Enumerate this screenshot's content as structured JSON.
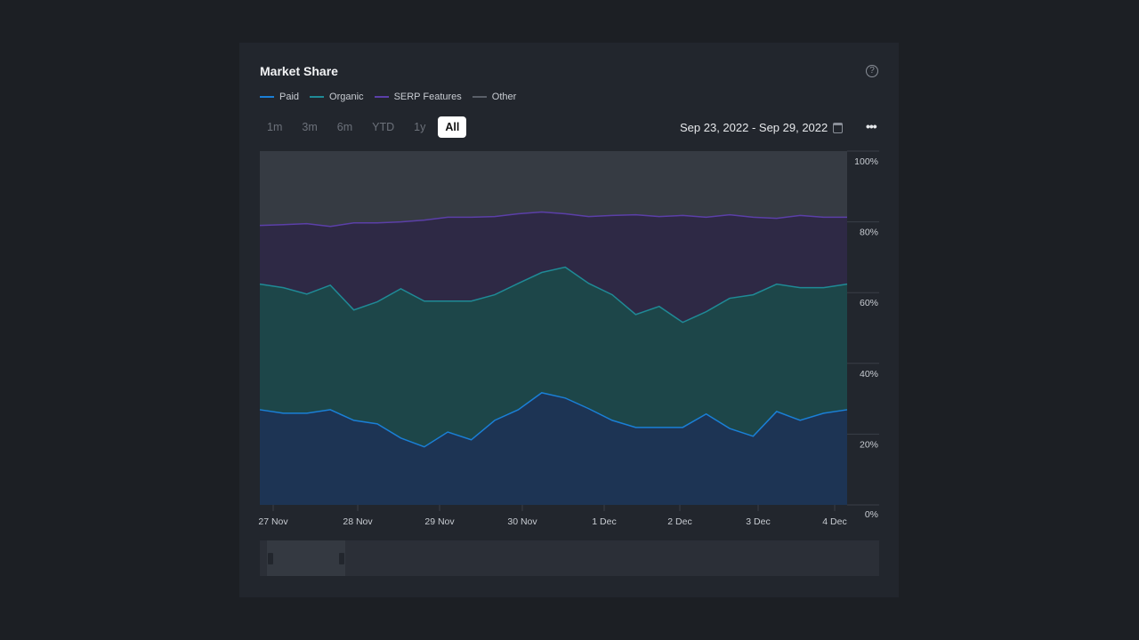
{
  "card": {
    "title": "Market Share",
    "help_icon": "question-circle-icon",
    "more_icon": "ellipsis-icon",
    "calendar_icon": "calendar-icon"
  },
  "ranges": [
    {
      "label": "1m"
    },
    {
      "label": "3m"
    },
    {
      "label": "6m"
    },
    {
      "label": "YTD"
    },
    {
      "label": "1y"
    },
    {
      "label": "All",
      "active": true
    }
  ],
  "date_range": "Sep 23, 2022 - Sep 29, 2022",
  "chart_data": {
    "type": "area",
    "stacked": true,
    "legend_position": "top-left",
    "series": [
      {
        "name": "Paid",
        "color": "#1a7fd6",
        "fill": "#1d3454",
        "values": [
          26.9,
          25.9,
          25.9,
          26.9,
          23.9,
          22.9,
          18.9,
          16.4,
          20.6,
          18.4,
          23.9,
          26.9,
          31.7,
          30.2,
          27.2,
          23.9,
          21.9,
          21.9,
          21.9,
          25.7,
          21.6,
          19.4,
          26.4,
          23.9,
          25.9,
          26.9
        ]
      },
      {
        "name": "Organic",
        "color": "#1f8a96",
        "fill": "#1d4649",
        "values": [
          35.5,
          35.5,
          33.7,
          35.2,
          31.2,
          34.5,
          42.2,
          41.2,
          37.0,
          39.2,
          35.5,
          35.7,
          34.0,
          37.0,
          35.4,
          35.5,
          31.9,
          34.2,
          29.7,
          28.9,
          36.8,
          40.0,
          36.0,
          37.5,
          35.5,
          35.5
        ]
      },
      {
        "name": "SERP Features",
        "color": "#5b3fa8",
        "fill": "#2e2945",
        "values": [
          16.6,
          17.8,
          19.9,
          16.6,
          24.6,
          22.3,
          18.9,
          22.9,
          23.7,
          23.7,
          22.1,
          19.7,
          17.1,
          15.1,
          18.9,
          22.4,
          28.2,
          25.4,
          30.2,
          26.7,
          23.6,
          21.9,
          18.6,
          20.4,
          19.9,
          18.9
        ]
      },
      {
        "name": "Other",
        "color": "#5a5f68",
        "fill": "#363b43",
        "values": [
          21.0,
          20.8,
          20.5,
          21.3,
          20.3,
          20.3,
          20.0,
          19.5,
          18.7,
          18.7,
          18.5,
          17.7,
          17.2,
          17.7,
          18.5,
          18.2,
          18.0,
          18.5,
          18.2,
          18.7,
          18.0,
          18.7,
          19.0,
          18.2,
          18.7,
          18.7
        ]
      }
    ],
    "x_ticks": [
      "27 Nov",
      "28 Nov",
      "29 Nov",
      "30 Nov",
      "1 Dec",
      "2 Dec",
      "3 Dec",
      "4 Dec"
    ],
    "y_ticks": [
      "0%",
      "20%",
      "40%",
      "60%",
      "80%",
      "100%"
    ],
    "ylim": [
      0,
      100
    ],
    "grid": true
  }
}
